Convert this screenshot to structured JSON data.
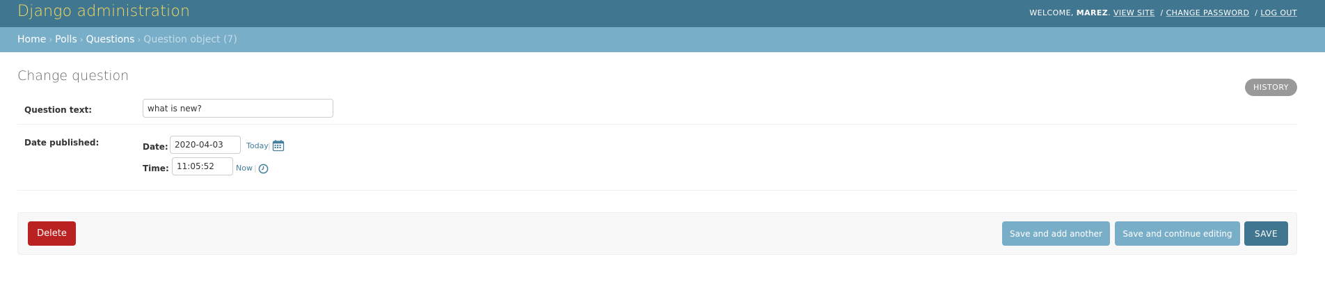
{
  "header": {
    "brand": "Django administration",
    "welcome": "WELCOME,",
    "username": "MAREZ",
    "view_site": "VIEW SITE",
    "change_password": "CHANGE PASSWORD",
    "log_out": "LOG OUT",
    "separator": "/"
  },
  "breadcrumbs": {
    "home": "Home",
    "app": "Polls",
    "model": "Questions",
    "current": "Question object (7)",
    "arrow": "›"
  },
  "page": {
    "title": "Change question",
    "history": "HISTORY"
  },
  "form": {
    "question_text": {
      "label": "Question text:",
      "value": "what is new?"
    },
    "date_published": {
      "label": "Date published:",
      "date_label": "Date:",
      "date_value": "2020-04-03",
      "today_link": "Today",
      "time_label": "Time:",
      "time_value": "11:05:52",
      "now_link": "Now",
      "pipe": "|",
      "calendar_icon": "calendar-icon",
      "clock_icon": "clock-icon"
    }
  },
  "actions": {
    "delete": "Delete",
    "save_add_another": "Save and add another",
    "save_continue": "Save and continue editing",
    "save": "SAVE"
  },
  "colors": {
    "header_bg": "#417690",
    "brand": "#f5dd5d",
    "breadcrumb_bg": "#79aec8",
    "delete": "#ba2121",
    "primary": "#417690",
    "secondary": "#79aec8"
  }
}
